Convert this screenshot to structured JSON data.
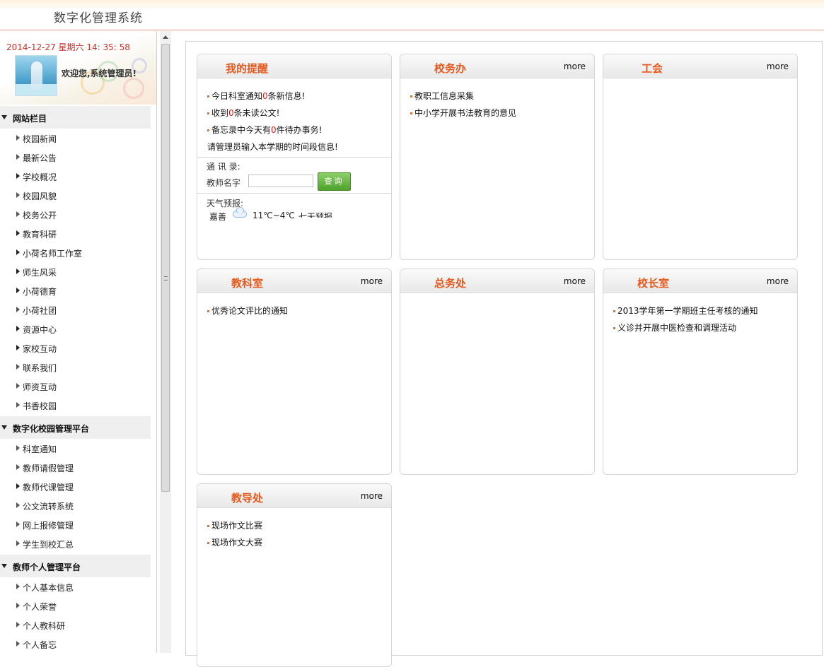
{
  "header": {
    "title": "数字化管理系统"
  },
  "sidebar": {
    "clock": "2014-12-27 星期六 14: 35: 58",
    "welcome": "欢迎您,系统管理员!",
    "groups": [
      {
        "label": "网站栏目",
        "items": [
          "校园新闻",
          "最新公告",
          "学校概况",
          "校园风貌",
          "校务公开",
          "教育科研",
          "小荷名师工作室",
          "师生风采",
          "小荷德育",
          "小荷社团",
          "资源中心",
          "家校互动",
          "联系我们",
          "师资互动",
          "书香校园"
        ]
      },
      {
        "label": "数字化校园管理平台",
        "items": [
          "科室通知",
          "教师请假管理",
          "教师代课管理",
          "公文流转系统",
          "网上报修管理",
          "学生到校汇总"
        ]
      },
      {
        "label": "教师个人管理平台",
        "items": [
          "个人基本信息",
          "个人荣誉",
          "个人教科研",
          "个人备忘"
        ]
      }
    ]
  },
  "panels": {
    "reminder": {
      "title": "我的提醒",
      "line1_a": "今日科室通知",
      "line1_n": "0",
      "line1_b": "条新信息!",
      "line2_a": "收到",
      "line2_n": "0",
      "line2_b": "条未读公文!",
      "line3_a": "备忘录中今天有",
      "line3_n": "0",
      "line3_b": "件待办事务!",
      "line4": "请管理员输入本学期的时间段信息!",
      "contacts_label": "通 讯 录:",
      "teacher_label": "教师名字",
      "query_button": "查询",
      "weather_label": "天气预报:",
      "weather_city": "嘉善",
      "weather_temp": "11℃~4℃",
      "weather_link": "七天预报"
    },
    "office": {
      "title": "校务办",
      "more": "more",
      "items": [
        "教职工信息采集",
        "中小学开展书法教育的意见"
      ]
    },
    "union": {
      "title": "工会",
      "more": "more",
      "items": []
    },
    "research": {
      "title": "教科室",
      "more": "more",
      "items": [
        "优秀论文评比的通知"
      ]
    },
    "general": {
      "title": "总务处",
      "more": "more",
      "items": []
    },
    "principal": {
      "title": "校长室",
      "more": "more",
      "items": [
        "2013学年第一学期班主任考核的通知",
        "义诊并开展中医检查和调理活动"
      ]
    },
    "guidance": {
      "title": "教导处",
      "more": "more",
      "items": [
        "现场作文比赛",
        "现场作文大赛"
      ]
    }
  }
}
